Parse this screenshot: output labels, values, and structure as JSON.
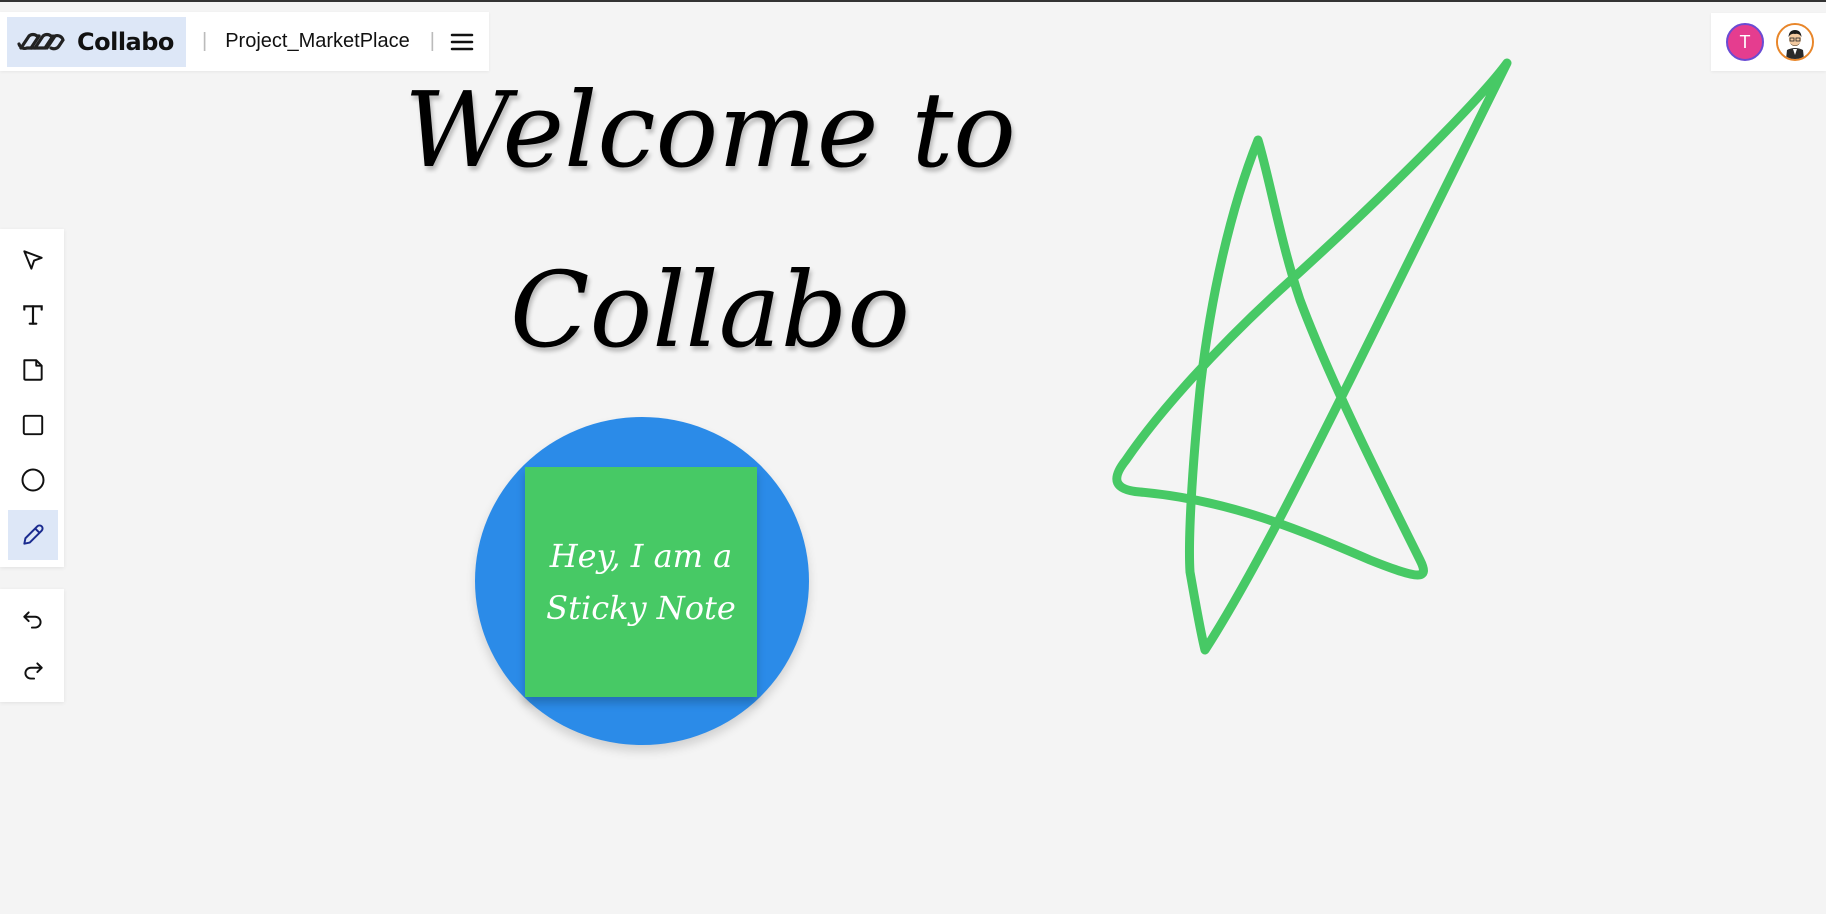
{
  "app": {
    "brand_name": "Collabo",
    "project_name": "Project_MarketPlace",
    "separator": "|"
  },
  "header": {
    "menu_icon": "hamburger-menu-icon"
  },
  "collaborators": [
    {
      "initial": "T",
      "color": "#e53d8f"
    },
    {
      "avatar": "cartoon-person-avatar"
    }
  ],
  "tools": [
    {
      "name": "select",
      "icon": "pointer-arrow-icon",
      "active": false
    },
    {
      "name": "text",
      "icon": "text-t-icon",
      "active": false
    },
    {
      "name": "sticky-note",
      "icon": "sticky-note-icon",
      "active": false
    },
    {
      "name": "rectangle",
      "icon": "square-icon",
      "active": false
    },
    {
      "name": "ellipse",
      "icon": "circle-icon",
      "active": false
    },
    {
      "name": "pencil",
      "icon": "pencil-icon",
      "active": true
    }
  ],
  "history_tools": [
    {
      "name": "undo",
      "icon": "undo-arrow-icon"
    },
    {
      "name": "redo",
      "icon": "redo-arrow-icon"
    }
  ],
  "canvas": {
    "heading_text": "Welcome to\nCollabo",
    "sticky_note_text": "Hey, I am a Sticky Note",
    "circle_color": "#2b8be8",
    "sticky_color": "#47c965",
    "drawing_color": "#47c965",
    "accent": "#dde7f7"
  }
}
